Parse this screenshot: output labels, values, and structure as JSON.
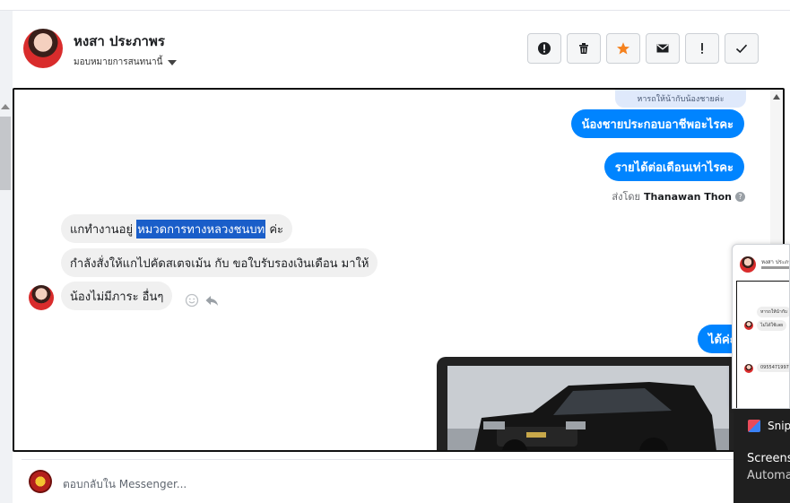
{
  "header": {
    "contact_name": "หงสา ประภาพร",
    "assign_label": "มอบหมายการสนทนานี้"
  },
  "actions": [
    {
      "icon": "alert-circle-icon"
    },
    {
      "icon": "trash-icon"
    },
    {
      "icon": "star-icon",
      "color": "#f5821f"
    },
    {
      "icon": "envelope-icon"
    },
    {
      "icon": "exclamation-icon"
    },
    {
      "icon": "check-icon"
    }
  ],
  "chat": {
    "faded_text": "หารถให้น้ากับน้องชายค่ะ",
    "outgoing": [
      "น้องชายประกอบอาชีพอะไรคะ",
      "รายได้ต่อเดือนเท่าไรคะ",
      "ได้ค่ะ"
    ],
    "sent_by_prefix": "ส่งโดย",
    "sent_by_name": "Thanawan Thon",
    "incoming": {
      "msg1_before": "แกทำงานอยู่ ",
      "msg1_highlight": "หมวดการทางหลวงชนบท",
      "msg1_after": " ค่ะ",
      "msg2": "กำลังสั่งให้แกไปคัดสเตจเม้น กับ ขอใบรับรองเงินเดือน มาให้",
      "msg3": "น้องไม่มีภาระ อื่นๆ"
    }
  },
  "composer": {
    "placeholder": "ตอบกลับใน Messenger..."
  },
  "popup": {
    "name": "หงสา ประภา",
    "line1": "หารถให้น้ากับ",
    "line2": "ไม่ได้ใช้เลย",
    "line3": "0955471997"
  },
  "toast": {
    "app": "Snip",
    "title": "Screens",
    "body": "Automa"
  },
  "colors": {
    "accent": "#0084ff",
    "highlight": "#1a5ec9",
    "star": "#f5821f"
  }
}
